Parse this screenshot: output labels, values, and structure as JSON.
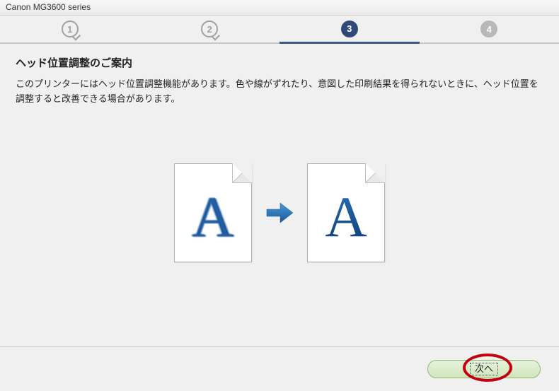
{
  "window": {
    "title": "Canon MG3600 series"
  },
  "stepper": {
    "steps": [
      {
        "label": "1",
        "state": "done"
      },
      {
        "label": "2",
        "state": "done"
      },
      {
        "label": "3",
        "state": "current"
      },
      {
        "label": "4",
        "state": "future"
      }
    ]
  },
  "content": {
    "heading": "ヘッド位置調整のご案内",
    "description": "このプリンターにはヘッド位置調整機能があります。色や線がずれたり、意図した印刷結果を得られないときに、ヘッド位置を調整すると改善できる場合があります。"
  },
  "illustration": {
    "left_letter": "A",
    "right_letter": "A",
    "arrow_color": "#2a78c0"
  },
  "footer": {
    "next_label": "次へ"
  },
  "colors": {
    "step_active": "#2f4a78",
    "button_bg": "#d9ecc8",
    "highlight": "#c00010"
  }
}
